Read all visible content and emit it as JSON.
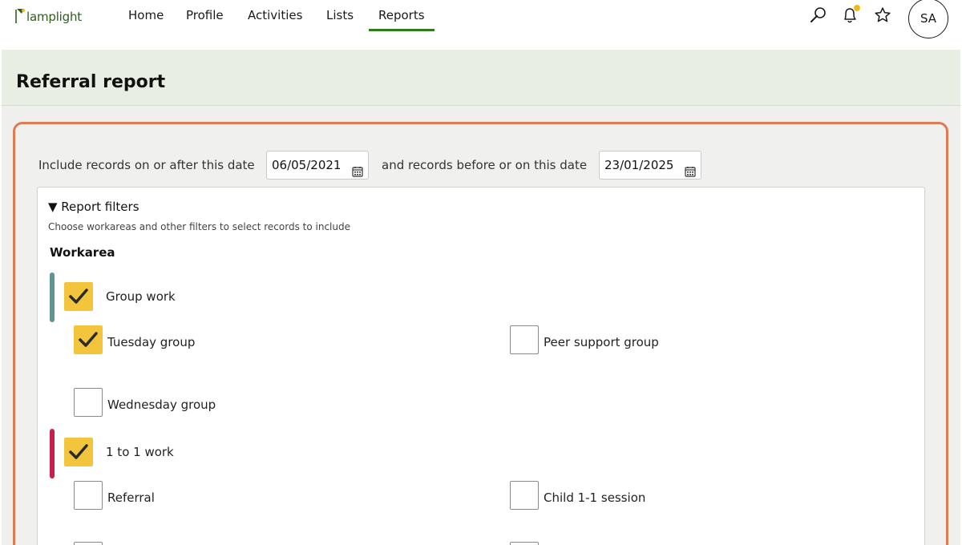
{
  "app": {
    "logo_text": "lamplight"
  },
  "nav": {
    "items": [
      {
        "label": "Home"
      },
      {
        "label": "Profile"
      },
      {
        "label": "Activities"
      },
      {
        "label": "Lists"
      },
      {
        "label": "Reports",
        "active": true
      }
    ],
    "icons": [
      "search-icon",
      "bell-icon",
      "star-icon"
    ],
    "avatar_initials": "SA",
    "accent_color": "#2e7d1a",
    "notification_dot_color": "#f0b81a"
  },
  "page": {
    "title": "Referral report"
  },
  "dates": {
    "after_label": "Include records on or after this date",
    "after_value": "06/05/2021",
    "before_label": "and records before or on this date",
    "before_value": "23/01/2025"
  },
  "filters": {
    "toggle_label": "▼ Report filters",
    "help_text": "Choose workareas and other filters to select records to include",
    "workarea_heading": "Workarea",
    "groups": [
      {
        "label": "Group work",
        "checked": true,
        "color": "#5f9494",
        "items": [
          {
            "label": "Tuesday group",
            "checked": true
          },
          {
            "label": "Peer support group",
            "checked": false
          },
          {
            "label": "Wednesday group",
            "checked": false
          }
        ]
      },
      {
        "label": "1 to 1 work",
        "checked": true,
        "color": "#c8204a",
        "items": [
          {
            "label": "Referral",
            "checked": false
          },
          {
            "label": "Child 1-1 session",
            "checked": false
          }
        ]
      }
    ]
  },
  "colors": {
    "panel_border": "#e07a52",
    "checkbox_checked": "#f2c53d",
    "header_bg": "#e8eee4"
  }
}
